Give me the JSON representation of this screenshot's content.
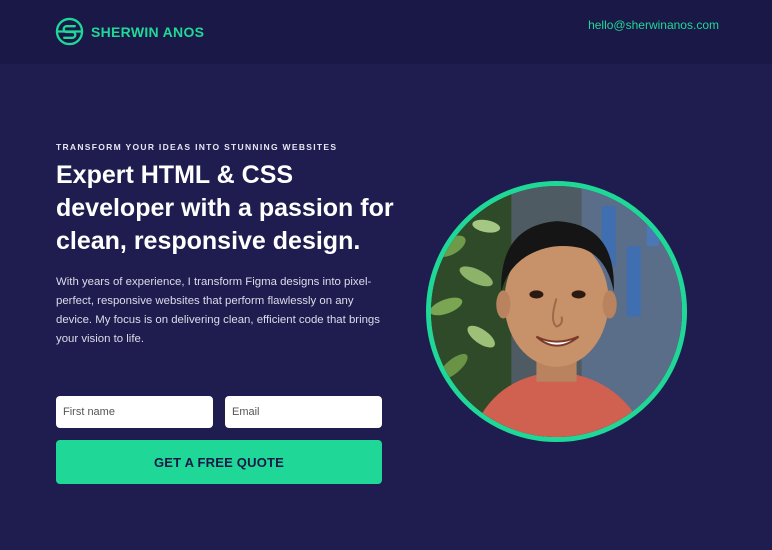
{
  "header": {
    "brand_name": "SHERWIN ANOS",
    "email": "hello@sherwinanos.com"
  },
  "hero": {
    "eyebrow": "TRANSFORM YOUR IDEAS INTO STUNNING WEBSITES",
    "headline": "Expert HTML & CSS developer with a passion for clean, responsive design.",
    "intro": "With years of experience, I transform Figma designs into pixel-perfect, responsive websites that perform flawlessly on any device. My focus is on delivering clean, efficient code that brings your vision to life."
  },
  "form": {
    "first_name_placeholder": "First name",
    "email_placeholder": "Email",
    "submit_label": "GET A FREE QUOTE"
  },
  "colors": {
    "background": "#1f1d4f",
    "header_background": "#1a1846",
    "accent": "#1fd898"
  },
  "icons": {
    "logo": "circle-s-logo-icon"
  }
}
